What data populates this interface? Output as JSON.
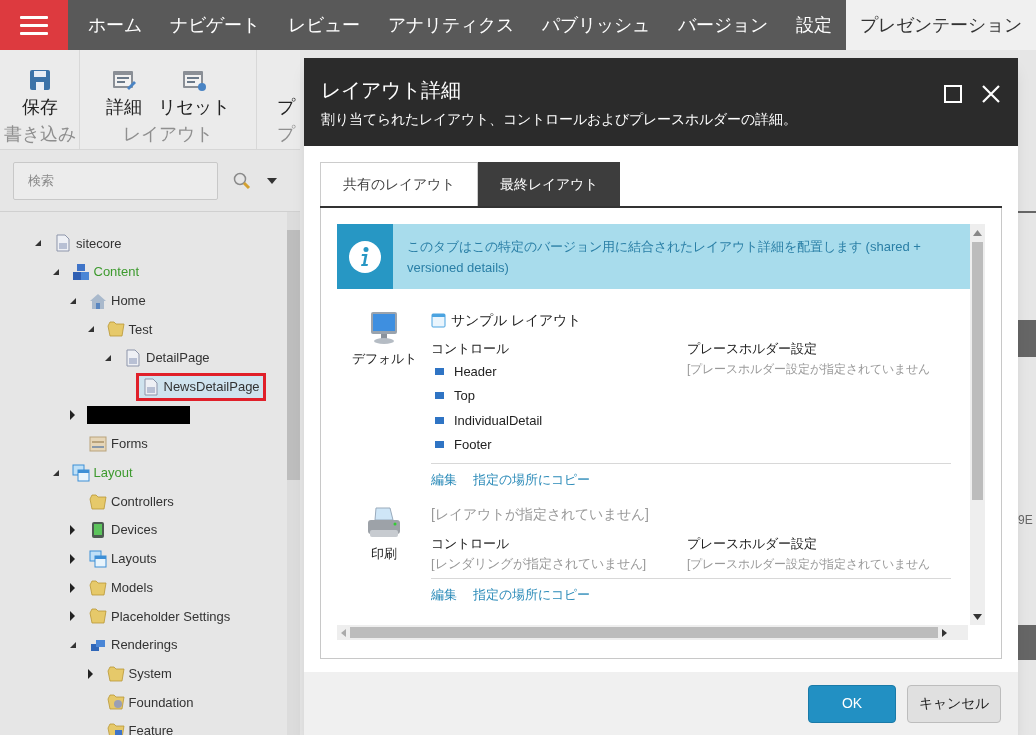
{
  "menu": {
    "items": [
      {
        "label": "ホーム",
        "selected": false
      },
      {
        "label": "ナビゲート",
        "selected": false
      },
      {
        "label": "レビュー",
        "selected": false
      },
      {
        "label": "アナリティクス",
        "selected": false
      },
      {
        "label": "パブリッシュ",
        "selected": false
      },
      {
        "label": "バージョン",
        "selected": false
      },
      {
        "label": "設定",
        "selected": false
      },
      {
        "label": "プレゼンテーション",
        "selected": true
      }
    ]
  },
  "ribbon": {
    "groups": [
      {
        "label": "書き込み",
        "buttons": [
          {
            "label": "保存",
            "kind": "save"
          }
        ]
      },
      {
        "label": "レイアウト",
        "buttons": [
          {
            "label": "詳細",
            "kind": "layout"
          },
          {
            "label": "リセット",
            "kind": "layout-reset"
          }
        ]
      },
      {
        "label": "プ",
        "buttons": [
          {
            "label": "プ",
            "kind": "none"
          }
        ]
      }
    ]
  },
  "search": {
    "placeholder": "検索"
  },
  "tree": [
    {
      "label": "sitecore",
      "kind": "page",
      "expanded": true,
      "selected": false,
      "color": "#333333",
      "children": [
        {
          "label": "Content",
          "kind": "content",
          "expanded": true,
          "selected": false,
          "color": "#3d9a2e",
          "children": [
            {
              "label": "Home",
              "kind": "home",
              "expanded": true,
              "selected": false,
              "color": "#333333",
              "children": [
                {
                  "label": "Test",
                  "kind": "folder",
                  "expanded": true,
                  "selected": false,
                  "color": "#333333",
                  "children": [
                    {
                      "label": "DetailPage",
                      "kind": "page",
                      "expanded": true,
                      "selected": false,
                      "color": "#333333",
                      "children": [
                        {
                          "label": "NewsDetailPage",
                          "kind": "page",
                          "selected": true,
                          "color": "#333333"
                        }
                      ]
                    }
                  ]
                }
              ]
            },
            {
              "kind": "redacted",
              "expanded": false
            },
            {
              "label": "Forms",
              "kind": "forms",
              "selected": false,
              "color": "#333333"
            }
          ]
        },
        {
          "label": "Layout",
          "kind": "layout",
          "expanded": true,
          "selected": false,
          "color": "#3d9a2e",
          "children": [
            {
              "label": "Controllers",
              "kind": "folder",
              "selected": false,
              "color": "#333333"
            },
            {
              "label": "Devices",
              "kind": "device",
              "expanded": false,
              "selected": false,
              "color": "#333333"
            },
            {
              "label": "Layouts",
              "kind": "layout",
              "expanded": false,
              "selected": false,
              "color": "#333333"
            },
            {
              "label": "Models",
              "kind": "folder",
              "expanded": false,
              "selected": false,
              "color": "#333333"
            },
            {
              "label": "Placeholder Settings",
              "kind": "folder",
              "expanded": false,
              "selected": false,
              "color": "#333333"
            },
            {
              "label": "Renderings",
              "kind": "renderings",
              "expanded": true,
              "selected": false,
              "color": "#333333",
              "children": [
                {
                  "label": "System",
                  "kind": "folder",
                  "expanded": false,
                  "selected": false,
                  "color": "#333333"
                },
                {
                  "label": "Foundation",
                  "kind": "folder-gear",
                  "selected": false,
                  "color": "#333333"
                },
                {
                  "label": "Feature",
                  "kind": "folder-blue",
                  "selected": false,
                  "color": "#333333"
                }
              ]
            }
          ]
        }
      ]
    }
  ],
  "background_text": "9E",
  "dialog": {
    "title": "レイアウト詳細",
    "subtitle": "割り当てられたレイアウト、コントロールおよびプレースホルダーの詳細。",
    "tabs": [
      {
        "label": "共有のレイアウト",
        "selected": false
      },
      {
        "label": "最終レイアウト",
        "selected": true
      }
    ],
    "info": "このタブはこの特定のバージョン用に結合されたレイアウト詳細を配置します (shared + versioned details)",
    "devices": [
      {
        "name": "デフォルト",
        "kind": "monitor",
        "layout": {
          "label": "サンプル レイアウト",
          "assigned": true
        },
        "controls_heading": "コントロール",
        "controls": [
          "Header",
          "Top",
          "IndividualDetail",
          "Footer"
        ],
        "placeholders_heading": "プレースホルダー設定",
        "placeholders_note": "[プレースホルダー設定が指定されていません",
        "links": [
          "編集",
          "指定の場所にコピー"
        ]
      },
      {
        "name": "印刷",
        "kind": "printer",
        "layout": {
          "label": "[レイアウトが指定されていません]",
          "assigned": false
        },
        "controls_heading": "コントロール",
        "controls_note": "[レンダリングが指定されていません]",
        "placeholders_heading": "プレースホルダー設定",
        "placeholders_note": "[プレースホルダー設定が指定されていません",
        "links": [
          "編集",
          "指定の場所にコピー"
        ]
      }
    ],
    "buttons": [
      {
        "label": "OK",
        "kind": "primary"
      },
      {
        "label": "キャンセル",
        "kind": "secondary"
      }
    ]
  }
}
